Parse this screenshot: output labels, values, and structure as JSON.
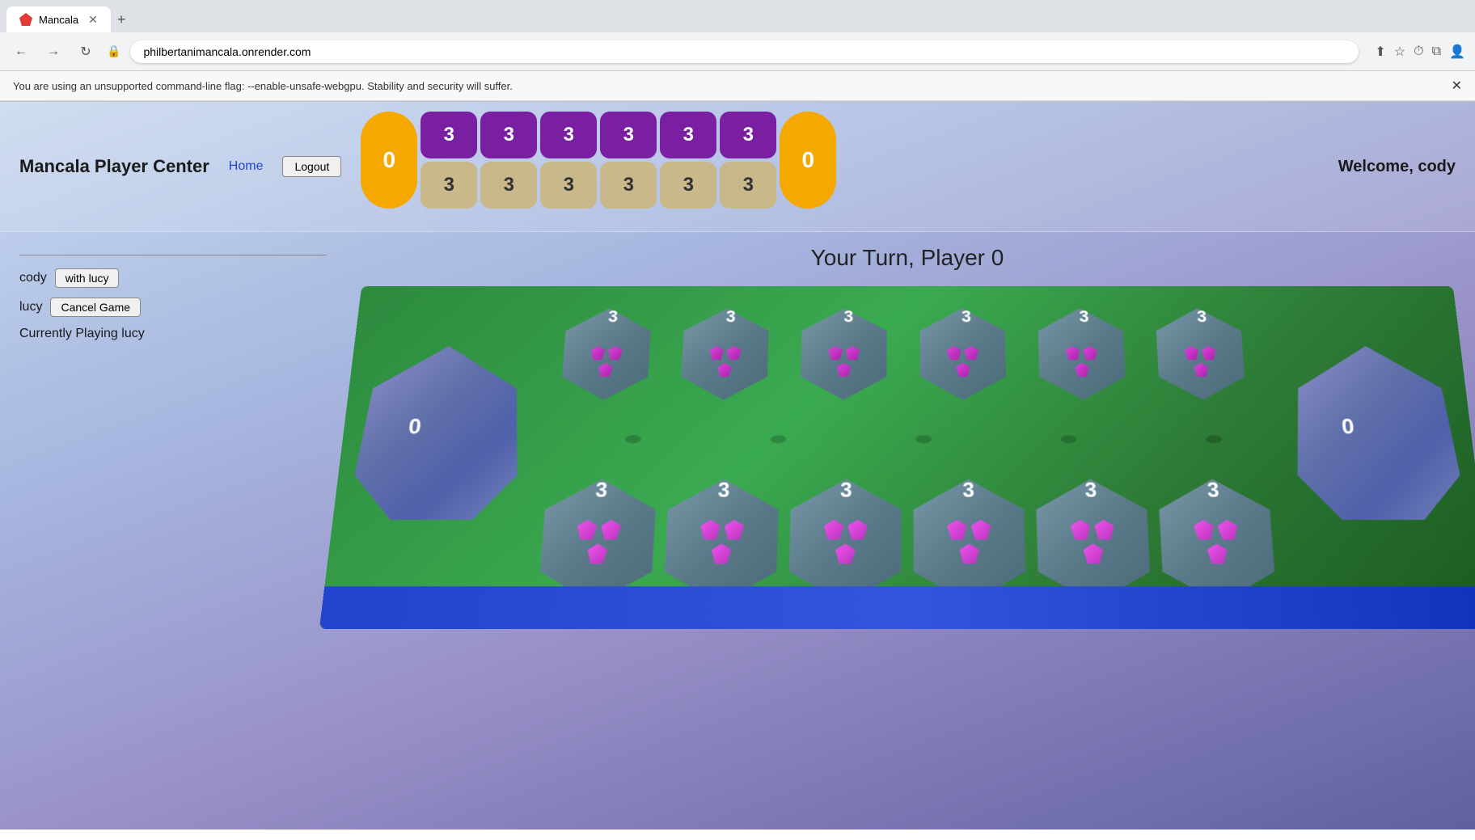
{
  "browser": {
    "tab_title": "Mancala",
    "url": "philbertanimancala.onrender.com",
    "warning": "You are using an unsupported command-line flag: --enable-unsafe-webgpu. Stability and security will suffer.",
    "nav": {
      "back": "←",
      "forward": "→",
      "refresh": "↻",
      "lock": "🔒"
    }
  },
  "header": {
    "title": "Mancala Player Center",
    "home_link": "Home",
    "logout_label": "Logout",
    "welcome": "Welcome, cody"
  },
  "sidebar": {
    "player1_name": "cody",
    "with_lucy_label": "with lucy",
    "player2_name": "lucy",
    "cancel_label": "Cancel Game",
    "currently_playing": "Currently Playing lucy"
  },
  "game": {
    "turn_text": "Your Turn, Player 0",
    "board": {
      "store_left_score": "0",
      "store_right_score": "0",
      "top_pits": [
        3,
        3,
        3,
        3,
        3,
        3
      ],
      "bottom_pits": [
        3,
        3,
        3,
        3,
        3,
        3
      ],
      "top_pit_color": "purple",
      "bottom_pit_color": "tan"
    },
    "board_3d": {
      "store_left_score": "0",
      "store_right_score": "0",
      "top_row_counts": [
        3,
        3,
        3,
        3,
        3,
        3
      ],
      "bottom_row_counts": [
        3,
        3,
        3,
        3,
        3,
        3
      ]
    }
  },
  "colors": {
    "purple_pit": "#7b1fa2",
    "tan_pit": "#c8b88a",
    "store_orange": "#f5a800",
    "board_green": "#2d8a3e",
    "gem_purple": "#cc44cc",
    "polyhedron_blue": "#7080bb"
  }
}
